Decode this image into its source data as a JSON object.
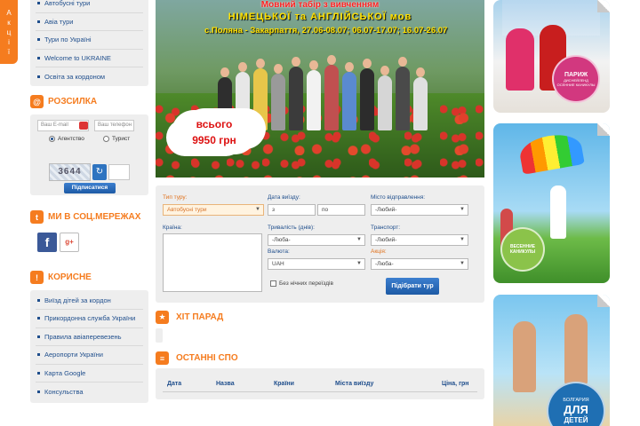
{
  "promo_tab": {
    "letters": [
      "А",
      "к",
      "ц",
      "і",
      "ї"
    ]
  },
  "left_menu": {
    "items": [
      "Автобусні тури",
      "Авіа тури",
      "Тури по Україні",
      "Welcome to UKRAINE",
      "Освіта за кордоном"
    ]
  },
  "newsletter": {
    "title": "РОЗСИЛКА",
    "email_placeholder": "Ваш E-mail",
    "phone_placeholder": "Ваш телефон",
    "radio_agency": "Агентство",
    "radio_tourist": "Турист",
    "captcha_text": "3644",
    "subscribe_label": "Підписатися"
  },
  "social": {
    "title": "МИ В СОЦ.МЕРЕЖАХ",
    "facebook": "f",
    "google": "g+"
  },
  "useful": {
    "title": "КОРИСНЕ",
    "items": [
      "Виїзд дітей за кордон",
      "Прикордонна служба України",
      "Правила авіаперевезень",
      "Аеропорти України",
      "Карта Google",
      "Консульства"
    ]
  },
  "banner": {
    "line1": "Мовний табір з вивченням",
    "line2": "НІМЕЦЬКОЇ та АНГЛІЙСЬКОЇ мов",
    "line3": "с.Поляна - Закарпаття, 27.06-08.07; 06.07-17.07; 16.07-26.07",
    "price_line1": "всього",
    "price_line2": "9950 грн"
  },
  "search": {
    "tour_type_label": "Тип туру:",
    "tour_type_value": "Автобусні тури",
    "departure_date_label": "Дата виїзду:",
    "date_from": "з",
    "date_to": "по",
    "departure_city_label": "Місто відправлення:",
    "departure_city_value": "-Любий-",
    "country_label": "Країна:",
    "duration_label": "Тривалість (днів):",
    "duration_value": "-Люба-",
    "transport_label": "Транспорт:",
    "transport_value": "-Любий-",
    "currency_label": "Валюта:",
    "currency_value": "UAH",
    "promo_label": "Акція:",
    "promo_value": "-Люба-",
    "no_night_label": "Без нічних переїздів",
    "submit_label": "Підібрати тур"
  },
  "hit_parade": {
    "title": "ХІТ ПАРАД"
  },
  "last_spo": {
    "title": "ОСТАННІ СПО",
    "columns": [
      "Дата",
      "Назва",
      "Країни",
      "Міста виїзду",
      "Ціна, грн"
    ]
  },
  "right_cards": {
    "paris_line1": "ПАРИЖ",
    "paris_line2": "ДИСНЕЙЛЕНД",
    "paris_line3": "ОСЕННИЕ КАНИКУЛЫ",
    "spring_line1": "ВЕСЕННИЕ",
    "spring_line2": "КАНИКУЛЫ",
    "bulgaria_line1": "БОЛГАРИЯ",
    "bulgaria_line2": "ДЛЯ",
    "bulgaria_line3": "ДЕТЕЙ"
  },
  "colors": {
    "accent": "#f57c1f",
    "link": "#1f4e8c",
    "panel": "#eeeeee"
  }
}
